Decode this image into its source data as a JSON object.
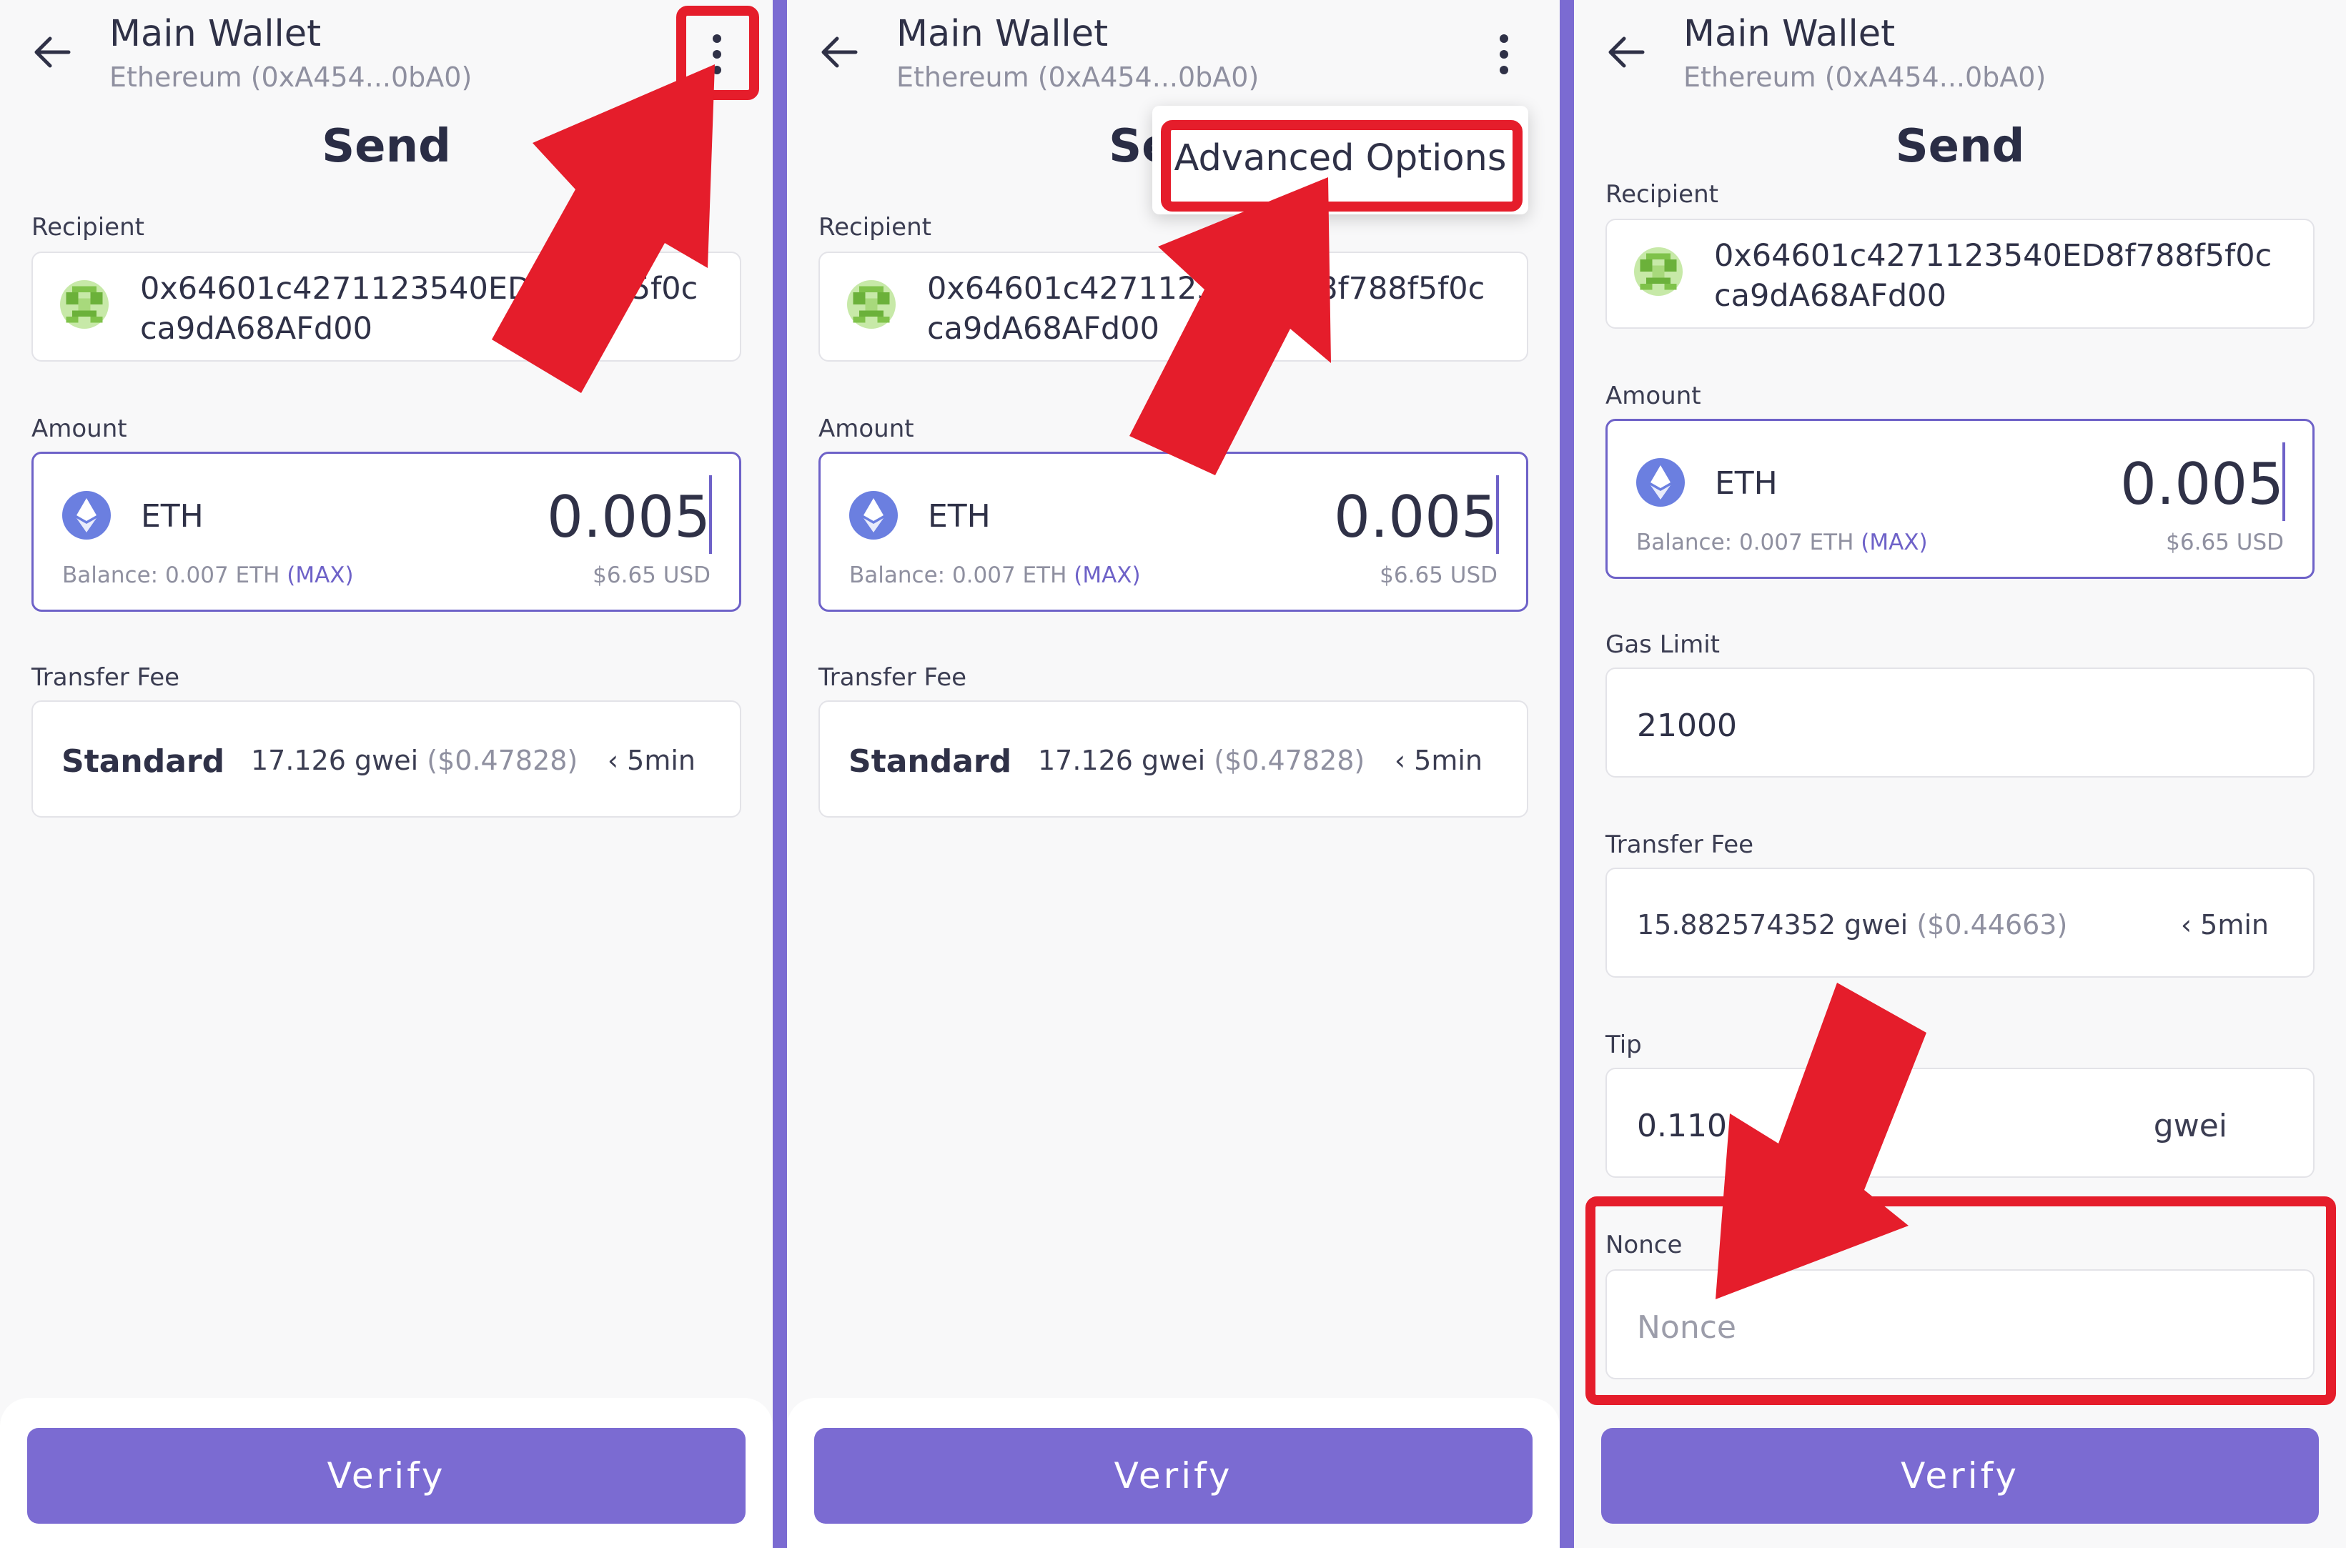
{
  "wallet": {
    "name": "Main Wallet",
    "network": "Ethereum (0xA454...0bA0)"
  },
  "page_title": "Send",
  "labels": {
    "recipient": "Recipient",
    "amount": "Amount",
    "transfer_fee": "Transfer Fee",
    "gas_limit": "Gas Limit",
    "tip": "Tip",
    "nonce": "Nonce"
  },
  "recipient": {
    "line1": "0x64601c4271123540ED8f788f5f0c",
    "line2": "ca9dA68AFd00"
  },
  "amount": {
    "coin": "ETH",
    "value": "0.005",
    "balance_label": "Balance:",
    "balance_value": "0.007 ETH",
    "max_label": "(MAX)",
    "usd": "$6.65 USD"
  },
  "fee_standard": {
    "name": "Standard",
    "gwei": "17.126 gwei",
    "usd": "($0.47828)",
    "time": "‹ 5min"
  },
  "fee_advanced": {
    "gwei": "15.882574352 gwei",
    "usd": "($0.44663)",
    "time": "‹ 5min"
  },
  "gas_limit_value": "21000",
  "tip": {
    "value": "0.110",
    "unit": "gwei"
  },
  "nonce_placeholder": "Nonce",
  "menu": {
    "advanced_options": "Advanced Options"
  },
  "verify_label": "Verify",
  "colors": {
    "accent": "#7b6bd2",
    "highlight": "#e51d2b",
    "background": "#f8f8f9"
  },
  "icons": [
    "back-arrow-icon",
    "kebab-menu-icon",
    "identicon-avatar",
    "ethereum-icon"
  ]
}
